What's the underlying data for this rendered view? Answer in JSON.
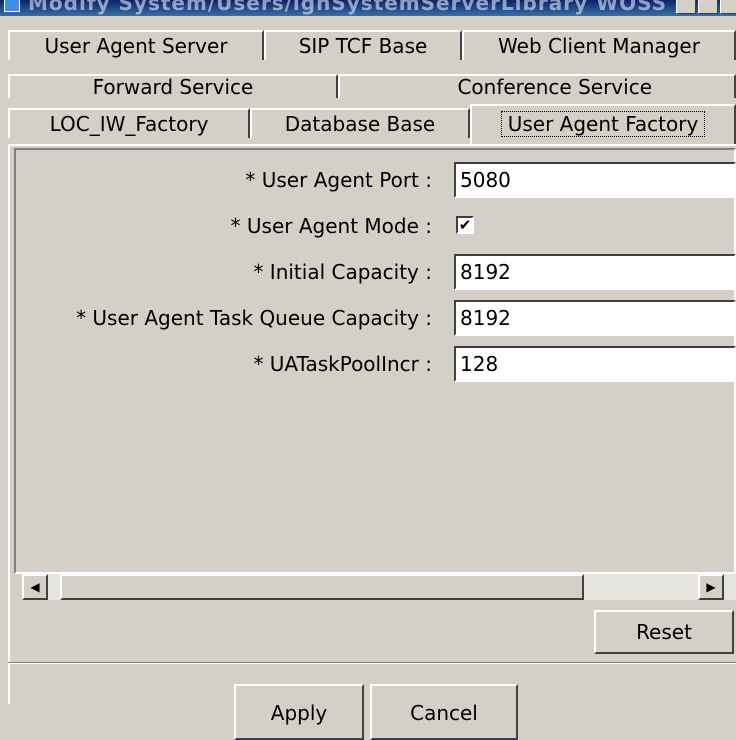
{
  "window": {
    "title": "Modify System/Users/ignSystemServerLibrary WOSS"
  },
  "tabs": {
    "row1": [
      "User Agent Server",
      "SIP TCF Base",
      "Web Client Manager"
    ],
    "row2": [
      "Forward Service",
      "Conference  Service"
    ],
    "row3": [
      "LOC_IW_Factory",
      "Database Base",
      "User Agent Factory"
    ],
    "active": "User Agent Factory"
  },
  "form": {
    "fields": [
      {
        "label": "* User Agent Port :",
        "value": "5080",
        "type": "text"
      },
      {
        "label": "* User Agent Mode :",
        "value": "checked",
        "type": "checkbox"
      },
      {
        "label": "* Initial Capacity :",
        "value": "8192",
        "type": "text"
      },
      {
        "label": "* User Agent Task Queue Capacity :",
        "value": "8192",
        "type": "text"
      },
      {
        "label": "* UATaskPoolIncr :",
        "value": "128",
        "type": "text"
      }
    ]
  },
  "buttons": {
    "reset": "Reset",
    "apply": "Apply",
    "cancel": "Cancel"
  },
  "icons": {
    "scroll_left": "◀",
    "scroll_right": "▶",
    "check": "✔"
  }
}
